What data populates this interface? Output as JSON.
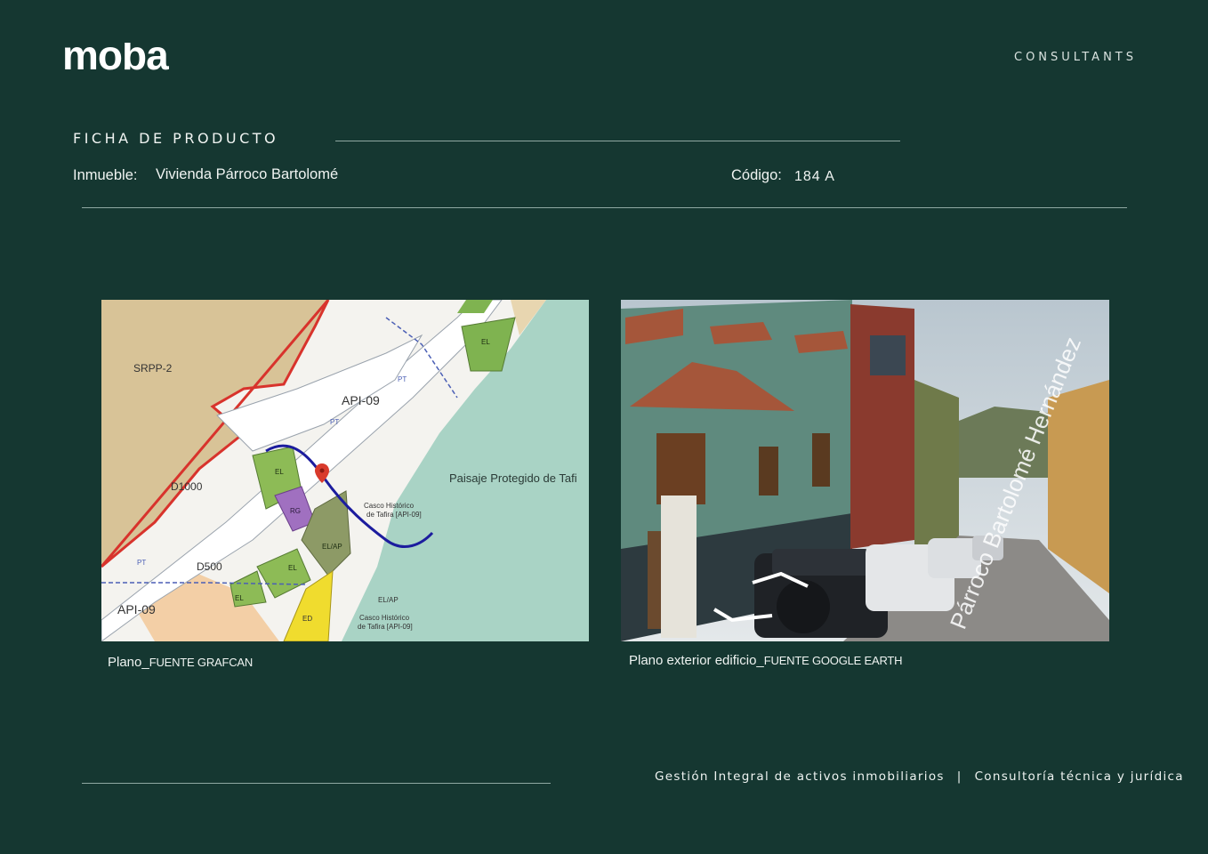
{
  "header": {
    "logo_text": "moba",
    "tagline": "CONSULTANTS"
  },
  "product": {
    "section_title": "FICHA DE PRODUCTO",
    "property_label": "Inmueble:",
    "property_value": "Vivienda Párroco Bartolomé",
    "code_label": "Código:",
    "code_value": "184 A"
  },
  "images": {
    "map": {
      "caption_main": "Plano_",
      "caption_source": "FUENTE GRAFCAN",
      "labels": {
        "srpp": "SRPP-2",
        "api_top": "API-09",
        "api_bottom": "API-09",
        "d1000": "D1000",
        "d500": "D500",
        "paisaje": "Paisaje Protegido de Tafi",
        "casco_1": "Casco Histórico",
        "casco_1b": "de Tafira [API-09]",
        "casco_2": "Casco Histórico",
        "casco_2b": "de Tafira [API-09]",
        "el": "EL",
        "rg": "RG",
        "ed": "ED",
        "elap": "EL/AP",
        "pt": "PT"
      }
    },
    "street": {
      "caption_main": "Plano exterior edificio_",
      "caption_source": "FUENTE GOOGLE EARTH",
      "street_name": "Párroco Bartolomé Hernández"
    }
  },
  "footer": {
    "left": "Gestión Integral de activos inmobiliarios",
    "separator": "|",
    "right": "Consultoría técnica y jurídica"
  },
  "colors": {
    "background": "#153731",
    "text": "#f0f4f2",
    "rule": "#8fa8a2"
  }
}
